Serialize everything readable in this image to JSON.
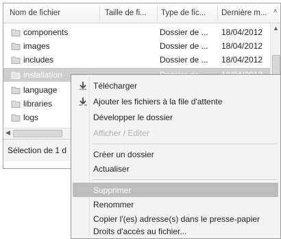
{
  "file_list": {
    "columns": [
      "Nom de fichier",
      "Taille de fi...",
      "Type de fic...",
      "Dernière m..."
    ],
    "rows": [
      {
        "name": "components",
        "type": "Dossier de ...",
        "date": "18/04/2012"
      },
      {
        "name": "images",
        "type": "Dossier de ...",
        "date": "18/04/2012"
      },
      {
        "name": "includes",
        "type": "Dossier de ...",
        "date": "18/04/2012"
      },
      {
        "name": "installation",
        "type": "Dossier de ...",
        "date": "18/04/2012",
        "selected": true
      },
      {
        "name": "language",
        "type": "",
        "date": ""
      },
      {
        "name": "libraries",
        "type": "",
        "date": ""
      },
      {
        "name": "logs",
        "type": "",
        "date": ""
      }
    ],
    "status": "Sélection de 1 d"
  },
  "context_menu": {
    "items": [
      {
        "label": "Télécharger",
        "icon": "download-arrow-icon",
        "disabled": false
      },
      {
        "label": "Ajouter les fichiers à la file d'attente",
        "icon": "add-to-queue-icon",
        "disabled": false
      },
      {
        "label": "Développer le dossier",
        "icon": "",
        "disabled": false
      },
      {
        "label": "Afficher / Editer",
        "icon": "",
        "disabled": true
      },
      {
        "label": "Créer un dossier",
        "icon": "",
        "disabled": false
      },
      {
        "label": "Actualiser",
        "icon": "",
        "disabled": false
      },
      {
        "label": "Supprimer",
        "icon": "",
        "disabled": false,
        "highlighted": true
      },
      {
        "label": "Renommer",
        "icon": "",
        "disabled": false
      },
      {
        "label": "Copier l'(es) adresse(s) dans le presse-papier",
        "icon": "",
        "disabled": false
      },
      {
        "label": "Droits d'accès au fichier...",
        "icon": "",
        "disabled": false
      }
    ]
  },
  "colors": {
    "selection": "#cdcdcd",
    "menu_highlight": "#bdbdbd",
    "folder": "#d9d9d9"
  }
}
